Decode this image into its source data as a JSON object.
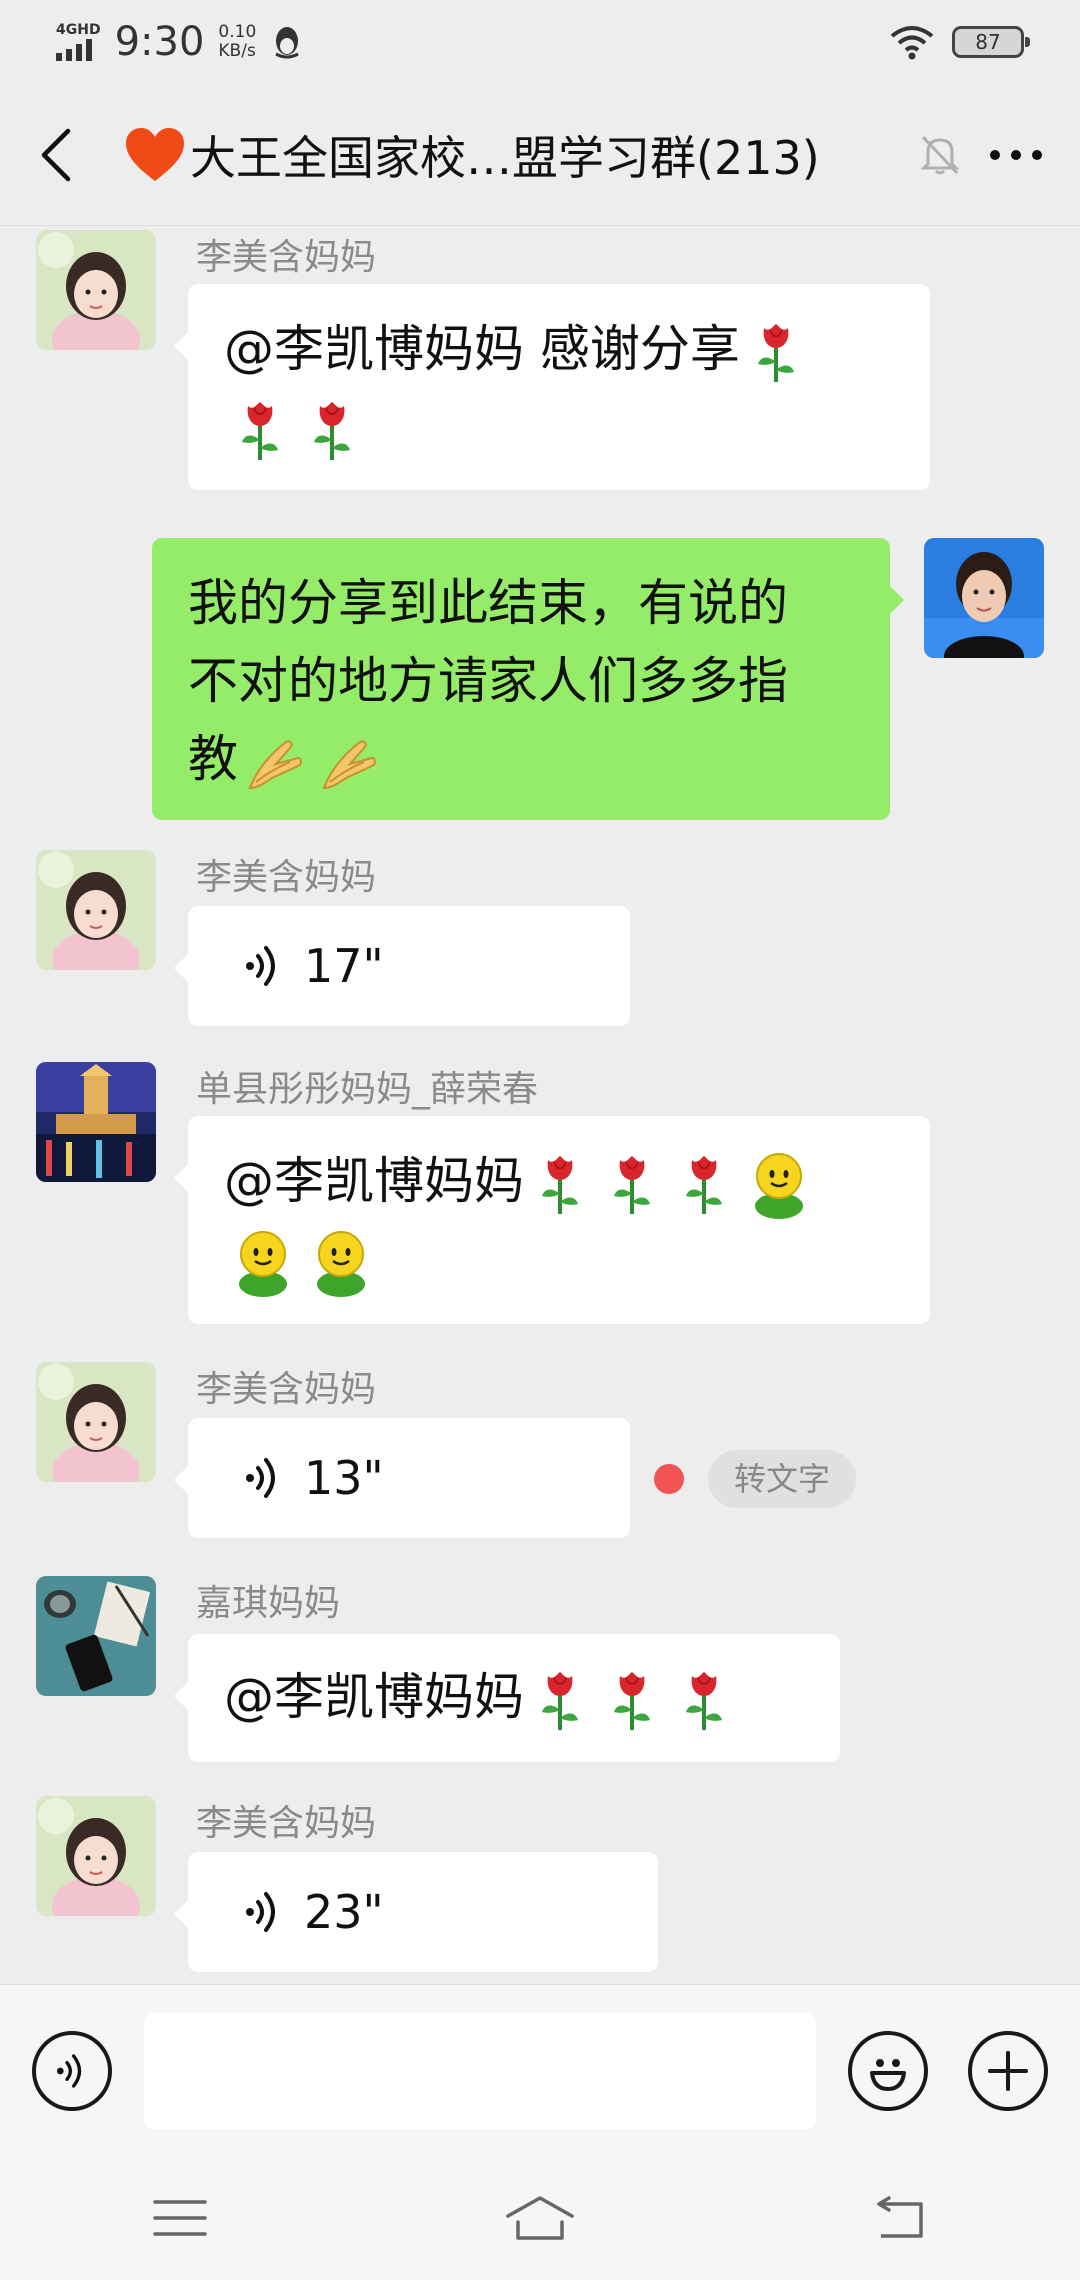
{
  "status_bar": {
    "network": "4GHD",
    "time": "9:30",
    "net_speed_value": "0.10",
    "net_speed_unit": "KB/s",
    "battery": "87"
  },
  "title_bar": {
    "heart": "❤️",
    "title": "大王全国家校…盟学习群(213)"
  },
  "messages": [
    {
      "sender": "李美含妈妈",
      "text_line1": "@李凯博妈妈  感谢分享"
    },
    {
      "text_line1": "我的分享到此结束，有说的",
      "text_line2": "不对的地方请家人们多多指",
      "text_line3": "教"
    },
    {
      "sender": "李美含妈妈",
      "voice_duration": "17\""
    },
    {
      "sender": "单县彤彤妈妈_薛荣春",
      "text_line1": "@李凯博妈妈"
    },
    {
      "sender": "李美含妈妈",
      "voice_duration": "13\"",
      "convert_label": "转文字"
    },
    {
      "sender": "嘉琪妈妈",
      "text_line1": "@李凯博妈妈"
    },
    {
      "sender": "李美含妈妈",
      "voice_duration": "23\""
    }
  ],
  "input_bar": {
    "placeholder": ""
  },
  "colors": {
    "background": "#ededed",
    "outgoing_bubble": "#95ec69",
    "incoming_bubble": "#ffffff",
    "unread_dot": "#f25454"
  },
  "icons": [
    "signal-icon",
    "qq-penguin-icon",
    "wifi-icon",
    "battery-icon",
    "back-icon",
    "mute-bell-icon",
    "more-icon",
    "voice-wave-icon",
    "rose-emoji-icon",
    "smiley-emoji-icon",
    "praying-hands-emoji-icon",
    "voice-mode-icon",
    "emoji-icon",
    "plus-icon",
    "menu-icon",
    "home-icon",
    "return-icon"
  ]
}
